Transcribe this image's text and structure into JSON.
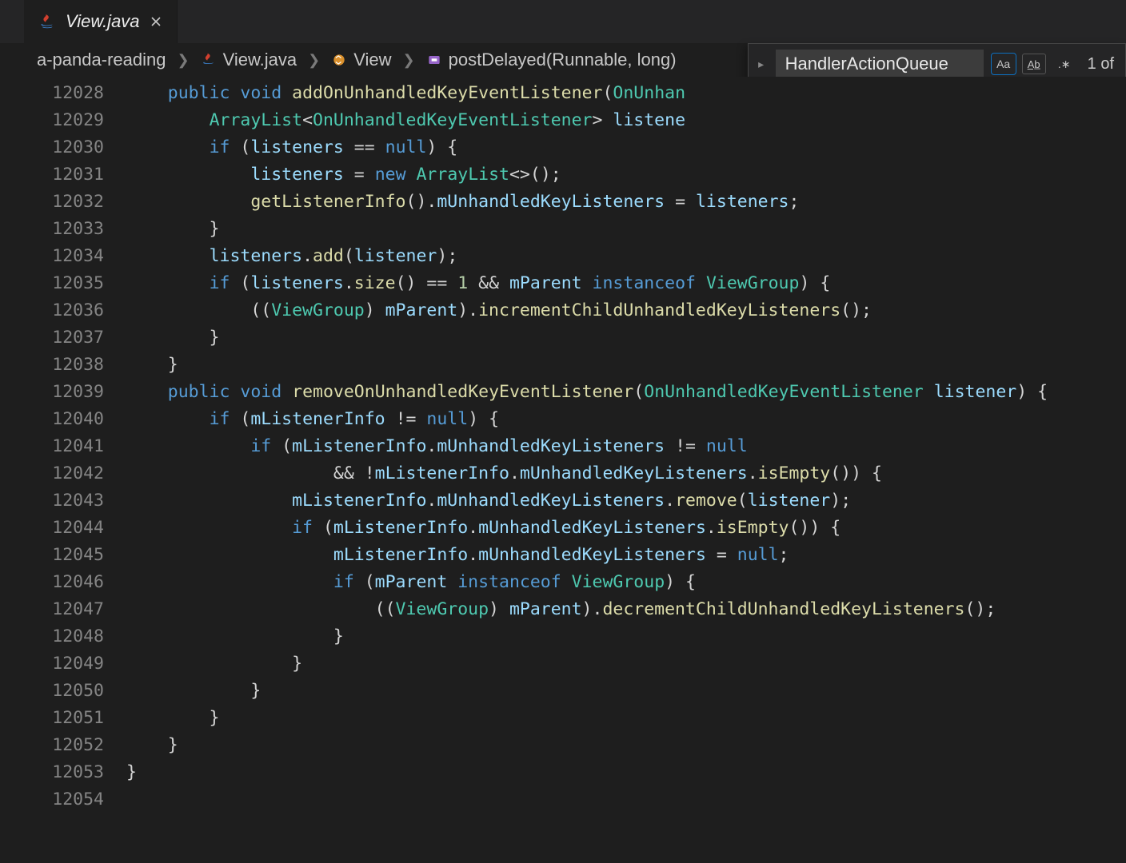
{
  "tab": {
    "filename": "View.java",
    "italic": true
  },
  "breadcrumb": {
    "project": "a-panda-reading",
    "file": "View.java",
    "class": "View",
    "method": "postDelayed(Runnable, long)"
  },
  "find": {
    "value": "HandlerActionQueue",
    "match_case_active": true,
    "count_label": "1 of"
  },
  "code": {
    "first_line_number": 12028,
    "lines": [
      [
        [
          "    ",
          ""
        ],
        [
          "public",
          "kw"
        ],
        [
          " ",
          ""
        ],
        [
          "void",
          "kw"
        ],
        [
          " ",
          ""
        ],
        [
          "addOnUnhandledKeyEventListener",
          "fn"
        ],
        [
          "(",
          ""
        ],
        [
          "OnUnhan",
          "type"
        ]
      ],
      [
        [
          "        ",
          ""
        ],
        [
          "ArrayList",
          "type"
        ],
        [
          "<",
          ""
        ],
        [
          "OnUnhandledKeyEventListener",
          "type"
        ],
        [
          "> ",
          ""
        ],
        [
          "listene",
          "var"
        ]
      ],
      [
        [
          "        ",
          ""
        ],
        [
          "if",
          "kw"
        ],
        [
          " (",
          ""
        ],
        [
          "listeners",
          "var"
        ],
        [
          " == ",
          ""
        ],
        [
          "null",
          "kw"
        ],
        [
          ") {",
          ""
        ]
      ],
      [
        [
          "            ",
          ""
        ],
        [
          "listeners",
          "var"
        ],
        [
          " = ",
          ""
        ],
        [
          "new",
          "kw"
        ],
        [
          " ",
          ""
        ],
        [
          "ArrayList",
          "type"
        ],
        [
          "<>();",
          ""
        ]
      ],
      [
        [
          "            ",
          ""
        ],
        [
          "getListenerInfo",
          "fn"
        ],
        [
          "().",
          ""
        ],
        [
          "mUnhandledKeyListeners",
          "field"
        ],
        [
          " = ",
          ""
        ],
        [
          "listeners",
          "var"
        ],
        [
          ";",
          ""
        ]
      ],
      [
        [
          "        }",
          ""
        ]
      ],
      [
        [
          "        ",
          ""
        ],
        [
          "listeners",
          "var"
        ],
        [
          ".",
          ""
        ],
        [
          "add",
          "fn"
        ],
        [
          "(",
          ""
        ],
        [
          "listener",
          "var"
        ],
        [
          ");",
          ""
        ]
      ],
      [
        [
          "        ",
          ""
        ],
        [
          "if",
          "kw"
        ],
        [
          " (",
          ""
        ],
        [
          "listeners",
          "var"
        ],
        [
          ".",
          ""
        ],
        [
          "size",
          "fn"
        ],
        [
          "() == ",
          ""
        ],
        [
          "1",
          "num"
        ],
        [
          " && ",
          ""
        ],
        [
          "mParent",
          "var"
        ],
        [
          " ",
          ""
        ],
        [
          "instanceof",
          "kw"
        ],
        [
          " ",
          ""
        ],
        [
          "ViewGroup",
          "type"
        ],
        [
          ") {",
          ""
        ]
      ],
      [
        [
          "            ((",
          ""
        ],
        [
          "ViewGroup",
          "type"
        ],
        [
          ") ",
          ""
        ],
        [
          "mParent",
          "var"
        ],
        [
          ").",
          ""
        ],
        [
          "incrementChildUnhandledKeyListeners",
          "fn"
        ],
        [
          "();",
          ""
        ]
      ],
      [
        [
          "        }",
          ""
        ]
      ],
      [
        [
          "    }",
          ""
        ]
      ],
      [
        [
          "    ",
          ""
        ],
        [
          "public",
          "kw"
        ],
        [
          " ",
          ""
        ],
        [
          "void",
          "kw"
        ],
        [
          " ",
          ""
        ],
        [
          "removeOnUnhandledKeyEventListener",
          "fn"
        ],
        [
          "(",
          ""
        ],
        [
          "OnUnhandledKeyEventListener",
          "type"
        ],
        [
          " ",
          ""
        ],
        [
          "listener",
          "var"
        ],
        [
          ") {",
          ""
        ]
      ],
      [
        [
          "        ",
          ""
        ],
        [
          "if",
          "kw"
        ],
        [
          " (",
          ""
        ],
        [
          "mListenerInfo",
          "var"
        ],
        [
          " != ",
          ""
        ],
        [
          "null",
          "kw"
        ],
        [
          ") {",
          ""
        ]
      ],
      [
        [
          "            ",
          ""
        ],
        [
          "if",
          "kw"
        ],
        [
          " (",
          ""
        ],
        [
          "mListenerInfo",
          "var"
        ],
        [
          ".",
          ""
        ],
        [
          "mUnhandledKeyListeners",
          "field"
        ],
        [
          " != ",
          ""
        ],
        [
          "null",
          "kw"
        ]
      ],
      [
        [
          "                    && !",
          ""
        ],
        [
          "mListenerInfo",
          "var"
        ],
        [
          ".",
          ""
        ],
        [
          "mUnhandledKeyListeners",
          "field"
        ],
        [
          ".",
          ""
        ],
        [
          "isEmpty",
          "fn"
        ],
        [
          "()) {",
          ""
        ]
      ],
      [
        [
          "                ",
          ""
        ],
        [
          "mListenerInfo",
          "var"
        ],
        [
          ".",
          ""
        ],
        [
          "mUnhandledKeyListeners",
          "field"
        ],
        [
          ".",
          ""
        ],
        [
          "remove",
          "fn"
        ],
        [
          "(",
          ""
        ],
        [
          "listener",
          "var"
        ],
        [
          ");",
          ""
        ]
      ],
      [
        [
          "                ",
          ""
        ],
        [
          "if",
          "kw"
        ],
        [
          " (",
          ""
        ],
        [
          "mListenerInfo",
          "var"
        ],
        [
          ".",
          ""
        ],
        [
          "mUnhandledKeyListeners",
          "field"
        ],
        [
          ".",
          ""
        ],
        [
          "isEmpty",
          "fn"
        ],
        [
          "()) {",
          ""
        ]
      ],
      [
        [
          "                    ",
          ""
        ],
        [
          "mListenerInfo",
          "var"
        ],
        [
          ".",
          ""
        ],
        [
          "mUnhandledKeyListeners",
          "field"
        ],
        [
          " = ",
          ""
        ],
        [
          "null",
          "kw"
        ],
        [
          ";",
          ""
        ]
      ],
      [
        [
          "                    ",
          ""
        ],
        [
          "if",
          "kw"
        ],
        [
          " (",
          ""
        ],
        [
          "mParent",
          "var"
        ],
        [
          " ",
          ""
        ],
        [
          "instanceof",
          "kw"
        ],
        [
          " ",
          ""
        ],
        [
          "ViewGroup",
          "type"
        ],
        [
          ") {",
          ""
        ]
      ],
      [
        [
          "                        ((",
          ""
        ],
        [
          "ViewGroup",
          "type"
        ],
        [
          ") ",
          ""
        ],
        [
          "mParent",
          "var"
        ],
        [
          ").",
          ""
        ],
        [
          "decrementChildUnhandledKeyListeners",
          "fn"
        ],
        [
          "();",
          ""
        ]
      ],
      [
        [
          "                    }",
          ""
        ]
      ],
      [
        [
          "                }",
          ""
        ]
      ],
      [
        [
          "            }",
          ""
        ]
      ],
      [
        [
          "        }",
          ""
        ]
      ],
      [
        [
          "    }",
          ""
        ]
      ],
      [
        [
          "}",
          ""
        ]
      ],
      [
        [
          "",
          ""
        ]
      ]
    ]
  }
}
